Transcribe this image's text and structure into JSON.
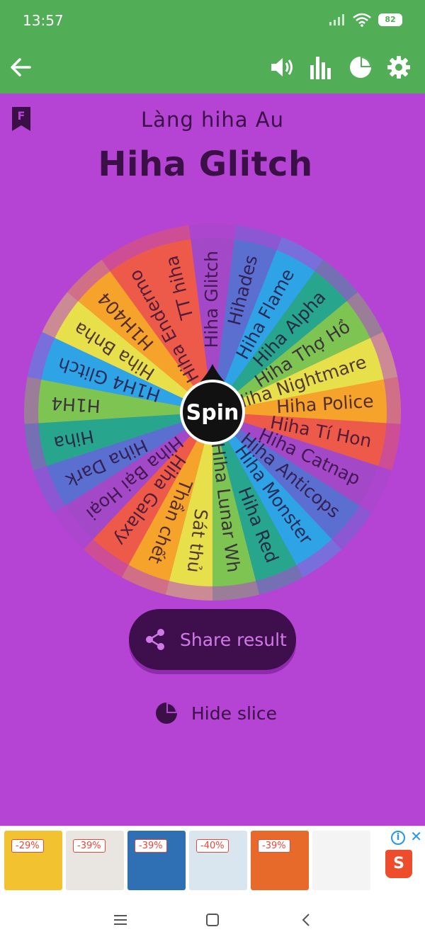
{
  "status_bar": {
    "time": "13:57",
    "battery": "82"
  },
  "app_bar": {
    "back_icon": "arrow-left-icon",
    "actions": [
      "volume-icon",
      "stats-icon",
      "pie-chart-icon",
      "gear-icon"
    ]
  },
  "header": {
    "bookmark_letter": "F",
    "subtitle": "Làng hiha Au",
    "title": "Hiha Glitch"
  },
  "wheel": {
    "center_label": "Spin",
    "slices": [
      {
        "label": "Hiha Glitch",
        "color": "#a349c8"
      },
      {
        "label": "Hihades",
        "color": "#5b6fd1"
      },
      {
        "label": "Hiha Flame",
        "color": "#2ea3e6"
      },
      {
        "label": "Hiha Alpha",
        "color": "#27a68d"
      },
      {
        "label": "Hiha Thợ Hồ",
        "color": "#7dc452"
      },
      {
        "label": "Hiha Nightmare",
        "color": "#e8e04a"
      },
      {
        "label": "Hiha Police",
        "color": "#f5a32b"
      },
      {
        "label": "Hiha Tí Hon",
        "color": "#ee5a4a"
      },
      {
        "label": "Hiha Catnap",
        "color": "#a349c8"
      },
      {
        "label": "Hiha Anticops",
        "color": "#5b6fd1"
      },
      {
        "label": "Hiha Monster",
        "color": "#2ea3e6"
      },
      {
        "label": "Hiha Red",
        "color": "#27a68d"
      },
      {
        "label": "Hiha Lunar Wh",
        "color": "#7dc452"
      },
      {
        "label": "Sát thủ",
        "color": "#e8e04a"
      },
      {
        "label": "Thần chết",
        "color": "#f5a32b"
      },
      {
        "label": "Hiha Galaxy",
        "color": "#ee5a4a"
      },
      {
        "label": "Hiha Bại Hoại",
        "color": "#a349c8"
      },
      {
        "label": "Hiha Dark",
        "color": "#5b6fd1"
      },
      {
        "label": "Hiha",
        "color": "#27a68d"
      },
      {
        "label": "H1H4",
        "color": "#7dc452"
      },
      {
        "label": "H1H4 Glitch",
        "color": "#2ea3e6"
      },
      {
        "label": "Hiha Bnha",
        "color": "#e8e04a"
      },
      {
        "label": "H1H404",
        "color": "#f5a32b"
      },
      {
        "label": "Hiha Endermo",
        "color": "#ee5a4a"
      },
      {
        "label": "TT hiha",
        "color": "#ee5a4a"
      }
    ]
  },
  "share_button": {
    "label": "Share result",
    "icon": "share-icon"
  },
  "hide_slice": {
    "label": "Hide slice",
    "icon": "pie-chart-icon"
  },
  "ads": {
    "items": [
      {
        "discount": "-29%",
        "color": "#f2c230"
      },
      {
        "discount": "-39%",
        "color": "#e9e6e2"
      },
      {
        "discount": "-39%",
        "color": "#2f6fb3"
      },
      {
        "discount": "-40%",
        "color": "#d9e6f0"
      },
      {
        "discount": "-39%",
        "color": "#e86a2a"
      },
      {
        "discount": "",
        "color": "#f4f4f4"
      }
    ],
    "store_icon": "S"
  },
  "nav_bar": [
    "menu-icon",
    "home-icon",
    "back-icon"
  ]
}
